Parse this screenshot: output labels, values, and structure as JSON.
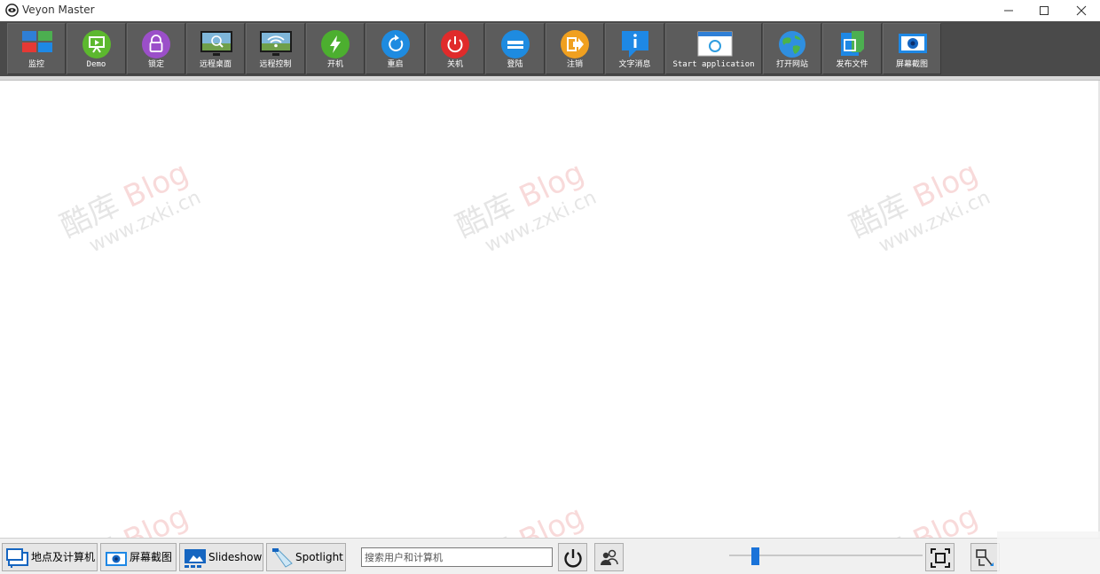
{
  "window": {
    "title": "Veyon Master",
    "minimize_glyph": "minimize-icon",
    "maximize_glyph": "maximize-icon",
    "close_glyph": "close-icon"
  },
  "toolbar": {
    "items": [
      {
        "id": "monitor",
        "label": "监控",
        "icon": "monitor-grid-icon"
      },
      {
        "id": "demo",
        "label": "Demo",
        "icon": "presentation-icon"
      },
      {
        "id": "lock",
        "label": "锁定",
        "icon": "lock-icon"
      },
      {
        "id": "remote-view",
        "label": "远程桌面",
        "icon": "remote-view-icon"
      },
      {
        "id": "remote-control",
        "label": "远程控制",
        "icon": "remote-control-icon"
      },
      {
        "id": "power-on",
        "label": "开机",
        "icon": "power-on-icon"
      },
      {
        "id": "reboot",
        "label": "重启",
        "icon": "reboot-icon"
      },
      {
        "id": "power-down",
        "label": "关机",
        "icon": "power-off-icon"
      },
      {
        "id": "login",
        "label": "登陆",
        "icon": "login-icon"
      },
      {
        "id": "logout",
        "label": "注销",
        "icon": "logout-icon"
      },
      {
        "id": "text-message",
        "label": "文字消息",
        "icon": "info-message-icon"
      },
      {
        "id": "start-app",
        "label": "Start application",
        "icon": "start-application-icon"
      },
      {
        "id": "open-website",
        "label": "打开网站",
        "icon": "globe-icon"
      },
      {
        "id": "send-file",
        "label": "发布文件",
        "icon": "file-transfer-icon"
      },
      {
        "id": "screenshot",
        "label": "屏幕截图",
        "icon": "camera-icon"
      }
    ]
  },
  "watermark": {
    "brand_cn": "酷库",
    "brand_en": "Blog",
    "url": "www.zxki.cn"
  },
  "bottombar": {
    "locations_label": "地点及计算机",
    "screenshots_label": "屏幕截图",
    "slideshow_label": "Slideshow",
    "spotlight_label": "Spotlight",
    "search_placeholder": "搜索用户和计算机",
    "power_icon": "power-icon",
    "users_icon": "users-icon",
    "fit_icon": "fit-to-window-icon",
    "arrange_icon": "arrange-icon",
    "zoom_level_fraction": 0.12
  },
  "colors": {
    "toolbar_bg": "#4a4a4a",
    "accent": "#1a73d9"
  }
}
